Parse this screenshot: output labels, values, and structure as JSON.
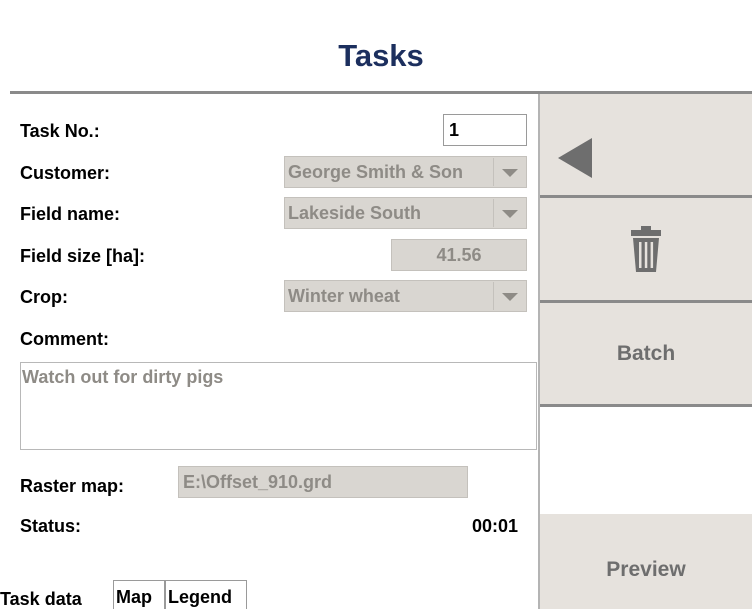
{
  "header": {
    "title": "Tasks"
  },
  "form": {
    "task_no": {
      "label": "Task No.:",
      "value": "1"
    },
    "customer": {
      "label": "Customer:",
      "value": "George Smith & Son"
    },
    "field_name": {
      "label": "Field name:",
      "value": "Lakeside South"
    },
    "field_size": {
      "label": "Field size [ha]:",
      "value": "41.56"
    },
    "crop": {
      "label": "Crop:",
      "value": "Winter wheat"
    },
    "comment": {
      "label": "Comment:",
      "value": "Watch out for dirty pigs"
    },
    "raster_map": {
      "label": "Raster map:",
      "value": "E:\\Offset_910.grd"
    },
    "status": {
      "label": "Status:",
      "value": "00:01"
    }
  },
  "tabs": [
    {
      "label": "Task data"
    },
    {
      "label": "Map"
    },
    {
      "label": "Legend"
    }
  ],
  "side_buttons": {
    "back_icon": "left-triangle-icon",
    "delete_icon": "trash-can-icon",
    "batch_label": "Batch",
    "preview_label": "Preview"
  },
  "colors": {
    "title": "#1c2f5e",
    "button_bg": "#e6e2dd",
    "disabled_field_bg": "#d9d6d1",
    "disabled_text": "#8e8b86"
  }
}
